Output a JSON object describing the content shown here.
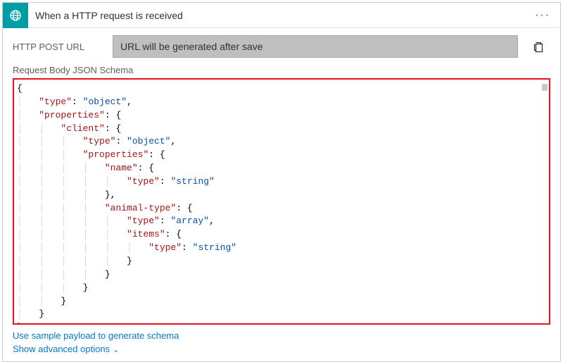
{
  "header": {
    "title": "When a HTTP request is received",
    "more": "···"
  },
  "urlRow": {
    "label": "HTTP POST URL",
    "value": "URL will be generated after save"
  },
  "schema": {
    "label": "Request Body JSON Schema",
    "lines": [
      {
        "guide": "",
        "tokens": [
          {
            "t": "brace",
            "v": "{"
          }
        ]
      },
      {
        "guide": "│   ",
        "tokens": [
          {
            "t": "key",
            "v": "\"type\""
          },
          {
            "t": "punct",
            "v": ": "
          },
          {
            "t": "str",
            "v": "\"object\""
          },
          {
            "t": "punct",
            "v": ","
          }
        ]
      },
      {
        "guide": "│   ",
        "tokens": [
          {
            "t": "key",
            "v": "\"properties\""
          },
          {
            "t": "punct",
            "v": ": "
          },
          {
            "t": "brace",
            "v": "{"
          }
        ]
      },
      {
        "guide": "│   │   ",
        "tokens": [
          {
            "t": "key",
            "v": "\"client\""
          },
          {
            "t": "punct",
            "v": ": "
          },
          {
            "t": "brace",
            "v": "{"
          }
        ]
      },
      {
        "guide": "│   │   │   ",
        "tokens": [
          {
            "t": "key",
            "v": "\"type\""
          },
          {
            "t": "punct",
            "v": ": "
          },
          {
            "t": "str",
            "v": "\"object\""
          },
          {
            "t": "punct",
            "v": ","
          }
        ]
      },
      {
        "guide": "│   │   │   ",
        "tokens": [
          {
            "t": "key",
            "v": "\"properties\""
          },
          {
            "t": "punct",
            "v": ": "
          },
          {
            "t": "brace",
            "v": "{"
          }
        ]
      },
      {
        "guide": "│   │   │   │   ",
        "tokens": [
          {
            "t": "key",
            "v": "\"name\""
          },
          {
            "t": "punct",
            "v": ": "
          },
          {
            "t": "brace",
            "v": "{"
          }
        ]
      },
      {
        "guide": "│   │   │   │   │   ",
        "tokens": [
          {
            "t": "key",
            "v": "\"type\""
          },
          {
            "t": "punct",
            "v": ": "
          },
          {
            "t": "str",
            "v": "\"string\""
          }
        ]
      },
      {
        "guide": "│   │   │   │   ",
        "tokens": [
          {
            "t": "brace",
            "v": "}"
          },
          {
            "t": "punct",
            "v": ","
          }
        ]
      },
      {
        "guide": "│   │   │   │   ",
        "tokens": [
          {
            "t": "key",
            "v": "\"animal-type\""
          },
          {
            "t": "punct",
            "v": ": "
          },
          {
            "t": "brace",
            "v": "{"
          }
        ]
      },
      {
        "guide": "│   │   │   │   │   ",
        "tokens": [
          {
            "t": "key",
            "v": "\"type\""
          },
          {
            "t": "punct",
            "v": ": "
          },
          {
            "t": "str",
            "v": "\"array\""
          },
          {
            "t": "punct",
            "v": ","
          }
        ]
      },
      {
        "guide": "│   │   │   │   │   ",
        "tokens": [
          {
            "t": "key",
            "v": "\"items\""
          },
          {
            "t": "punct",
            "v": ": "
          },
          {
            "t": "brace",
            "v": "{"
          }
        ]
      },
      {
        "guide": "│   │   │   │   │   │   ",
        "tokens": [
          {
            "t": "key",
            "v": "\"type\""
          },
          {
            "t": "punct",
            "v": ": "
          },
          {
            "t": "str",
            "v": "\"string\""
          }
        ]
      },
      {
        "guide": "│   │   │   │   │   ",
        "tokens": [
          {
            "t": "brace",
            "v": "}"
          }
        ]
      },
      {
        "guide": "│   │   │   │   ",
        "tokens": [
          {
            "t": "brace",
            "v": "}"
          }
        ]
      },
      {
        "guide": "│   │   │   ",
        "tokens": [
          {
            "t": "brace",
            "v": "}"
          }
        ]
      },
      {
        "guide": "│   │   ",
        "tokens": [
          {
            "t": "brace",
            "v": "}"
          }
        ]
      },
      {
        "guide": "│   ",
        "tokens": [
          {
            "t": "brace",
            "v": "}"
          }
        ]
      },
      {
        "guide": "",
        "tokens": [
          {
            "t": "brace",
            "v": "}"
          }
        ]
      }
    ]
  },
  "links": {
    "sample": "Use sample payload to generate schema",
    "advanced": "Show advanced options"
  }
}
